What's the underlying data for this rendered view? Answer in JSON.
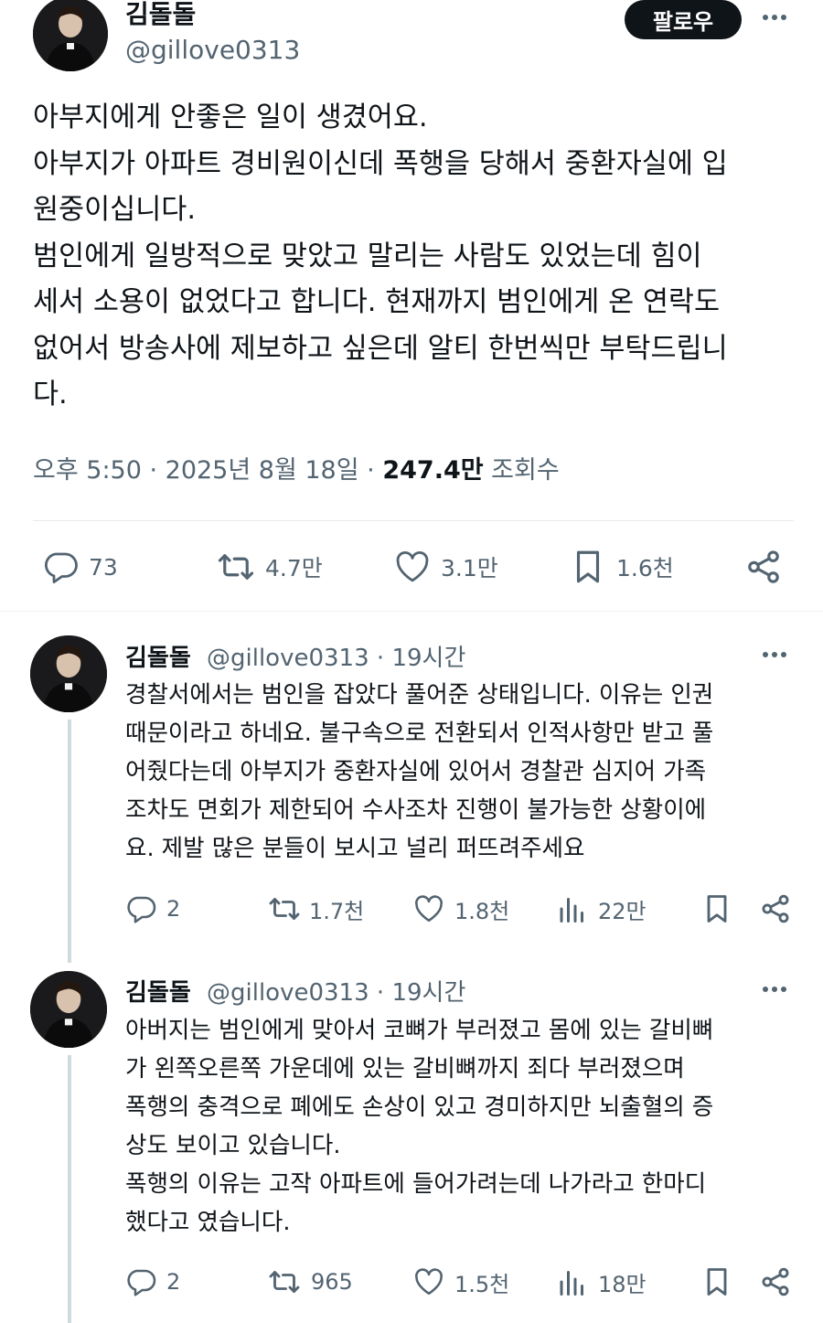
{
  "main_tweet": {
    "author_name": "김돌돌",
    "author_handle": "@gillove0313",
    "follow_label": "팔로우",
    "text_lines": [
      "아부지에게 안좋은 일이 생겼어요.",
      "아부지가 아파트 경비원이신데 폭행을 당해서 중환자실에 입",
      "원중이십니다.",
      "범인에게 일방적으로 맞았고 말리는 사람도 있었는데 힘이",
      "세서 소용이 없었다고 합니다. 현재까지 범인에게 온 연락도",
      "없어서 방송사에 제보하고 싶은데 알티 한번씩만 부탁드립니",
      "다."
    ],
    "timestamp": "오후 5:50 · 2025년 8월 18일 · ",
    "views_count": "247.4만",
    "views_label": " 조회수",
    "replies": "73",
    "retweets": "4.7만",
    "likes": "3.1만",
    "bookmarks": "1.6천"
  },
  "replies": [
    {
      "author_name": "김돌돌",
      "author_handle": "@gillove0313",
      "time": "19시간",
      "text_lines": [
        "경찰서에서는 범인을 잡았다 풀어준 상태입니다. 이유는 인권",
        "때문이라고 하네요. 불구속으로 전환되서 인적사항만 받고 풀",
        "어줬다는데 아부지가 중환자실에 있어서 경찰관 심지어 가족",
        "조차도 면회가 제한되어 수사조차 진행이 불가능한 상황이에",
        "요. 제발 많은 분들이 보시고 널리 퍼뜨려주세요"
      ],
      "replies": "2",
      "retweets": "1.7천",
      "likes": "1.8천",
      "views": "22만"
    },
    {
      "author_name": "김돌돌",
      "author_handle": "@gillove0313",
      "time": "19시간",
      "text_lines": [
        "아버지는 범인에게 맞아서 코뼈가 부러졌고 몸에 있는 갈비뼈",
        "가 왼쪽오른쪽 가운데에 있는 갈비뼈까지  죄다 부러졌으며",
        "폭행의 충격으로 폐에도 손상이 있고 경미하지만 뇌출혈의 증",
        "상도 보이고 있습니다.",
        "폭행의 이유는 고작 아파트에 들어가려는데 나가라고 한마디",
        "했다고 였습니다."
      ],
      "replies": "2",
      "retweets": "965",
      "likes": "1.5천",
      "views": "18만"
    }
  ],
  "colors": {
    "text": "#0f1419",
    "secondary": "#536471",
    "follow_bg": "#0f1419",
    "thread_line": "#cfd9de"
  },
  "icons": [
    "more-icon",
    "reply-icon",
    "retweet-icon",
    "like-icon",
    "bookmark-icon",
    "share-icon",
    "views-icon"
  ]
}
